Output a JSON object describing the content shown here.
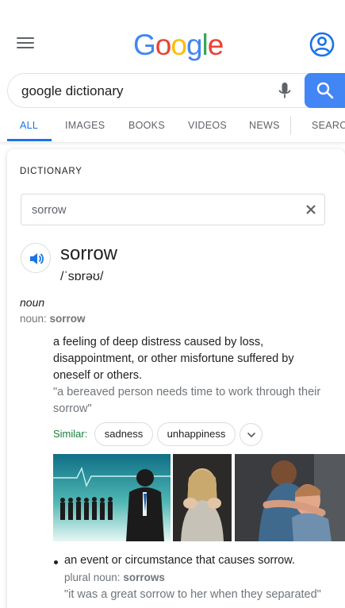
{
  "header": {
    "logo_text": "Google",
    "menu_icon": "hamburger-menu-icon",
    "account_icon": "account-circle-icon"
  },
  "search": {
    "query": "google dictionary",
    "mic_icon": "microphone-icon",
    "search_icon": "search-icon"
  },
  "tabs": [
    {
      "label": "ALL",
      "active": true
    },
    {
      "label": "IMAGES",
      "active": false
    },
    {
      "label": "BOOKS",
      "active": false
    },
    {
      "label": "VIDEOS",
      "active": false
    },
    {
      "label": "NEWS",
      "active": false
    },
    {
      "label": "SEARCH",
      "active": false
    }
  ],
  "dictionary": {
    "heading": "DICTIONARY",
    "input_value": "sorrow",
    "word": "sorrow",
    "phonetic": "/ˈsɒrəʊ/",
    "part_of_speech": "noun",
    "noun_prefix": "noun: ",
    "noun_word": "sorrow",
    "definition_1": "a feeling of deep distress caused by loss, disappointment, or other misfortune suffered by oneself or others.",
    "example_1": "\"a bereaved person needs time to work through their sorrow\"",
    "similar_label": "Similar:",
    "similar_chips": [
      "sadness",
      "unhappiness"
    ],
    "definition_2": "an event or circumstance that causes sorrow.",
    "plural_prefix": "plural noun: ",
    "plural_word": "sorrows",
    "example_2": "\"it was a great sorrow to her when they separated\""
  },
  "colors": {
    "accent": "#1a73e8",
    "search_button": "#4285f4",
    "similar_label": "#188038"
  }
}
